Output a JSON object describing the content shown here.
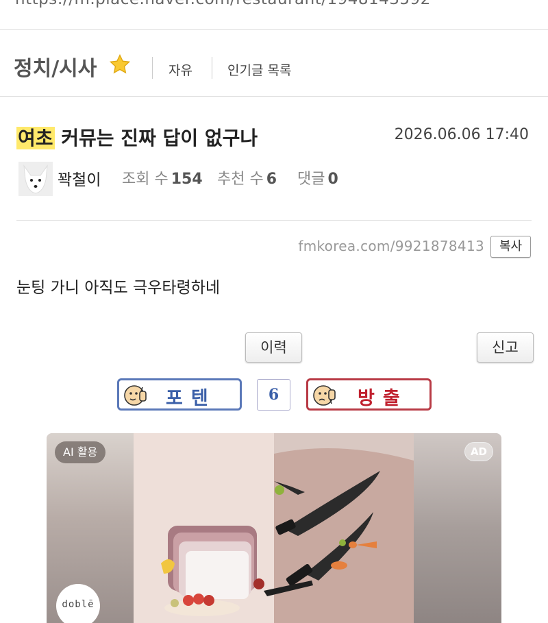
{
  "browser": {
    "url": "https://m.place.naver.com/restaurant/1948143592"
  },
  "board": {
    "title": "정치/시사",
    "links": [
      "자유",
      "인기글 목록"
    ]
  },
  "post": {
    "category": "여초",
    "title": "커뮤는 진짜 답이 없구나",
    "date": "2026.06.06 17:40",
    "author": "꽉철이",
    "stats": {
      "views_label": "조회 수",
      "views": "154",
      "likes_label": "추천 수",
      "likes": "6",
      "comments_label": "댓글",
      "comments": "0"
    },
    "short_url": "fmkorea.com/9921878413",
    "copy_label": "복사",
    "body": "눈팅 가니 아직도 극우타령하네"
  },
  "actions": {
    "history_label": "이력",
    "report_label": "신고"
  },
  "votes": {
    "up_label": "포텐",
    "count": "6",
    "down_label": "방출",
    "up_color": "#5a78b8",
    "down_color": "#b83a45"
  },
  "ad": {
    "ai_label": "AI 활용",
    "ad_label": "AD",
    "brand": "doblē"
  },
  "icons": {
    "star": "star-icon",
    "thumbs_up": "thumbs-up-face-icon",
    "thumbs_down": "thumbs-down-face-icon"
  },
  "colors": {
    "category_highlight": "#ffe96b"
  }
}
